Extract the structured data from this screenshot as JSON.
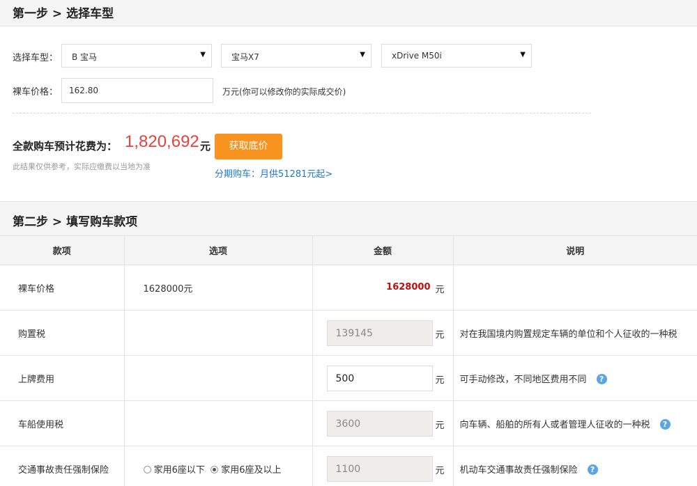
{
  "step1": {
    "title": "第一步 > 选择车型"
  },
  "car_select": {
    "label": "选择车型：",
    "brand": "B 宝马",
    "series": "宝马X7",
    "model": "xDrive M50i"
  },
  "price": {
    "label": "裸车价格：",
    "value": "162.80",
    "unit_note": "万元(你可以修改你的实际成交价)"
  },
  "total": {
    "label": "全款购车预计花费为：",
    "value": "1,820,692",
    "unit": "元",
    "button": "获取底价",
    "note": "此结果仅供参考，实际应缴费以当地为准",
    "installment": "分期购车：月供51281元起>"
  },
  "step2": {
    "title": "第二步 > 填写购车款项"
  },
  "table": {
    "headers": [
      "款项",
      "选项",
      "金额",
      "说明"
    ],
    "rows": [
      {
        "item": "裸车价格",
        "option": "1628000元",
        "amount": "1628000",
        "unit": "元",
        "desc": ""
      },
      {
        "item": "购置税",
        "option": "",
        "amount": "139145",
        "unit": "元",
        "desc": "对在我国境内购置规定车辆的单位和个人征收的一种税"
      },
      {
        "item": "上牌费用",
        "option": "",
        "amount": "500",
        "unit": "元",
        "desc": "可手动修改，不同地区费用不同"
      },
      {
        "item": "车船使用税",
        "option": "",
        "amount": "3600",
        "unit": "元",
        "desc": "向车辆、船舶的所有人或者管理人征收的一种税"
      },
      {
        "item": "交通事故责任强制保险",
        "option_a": "家用6座以下",
        "option_b": "家用6座及以上",
        "amount": "1100",
        "unit": "元",
        "desc": "机动车交通事故责任强制保险"
      }
    ]
  },
  "icons": {
    "dropdown": "▼",
    "help": "?"
  },
  "colors": {
    "accent": "#f7931e",
    "price_red": "#e8423a",
    "link_blue": "#1e78c8",
    "help_blue": "#5aa5e6"
  }
}
